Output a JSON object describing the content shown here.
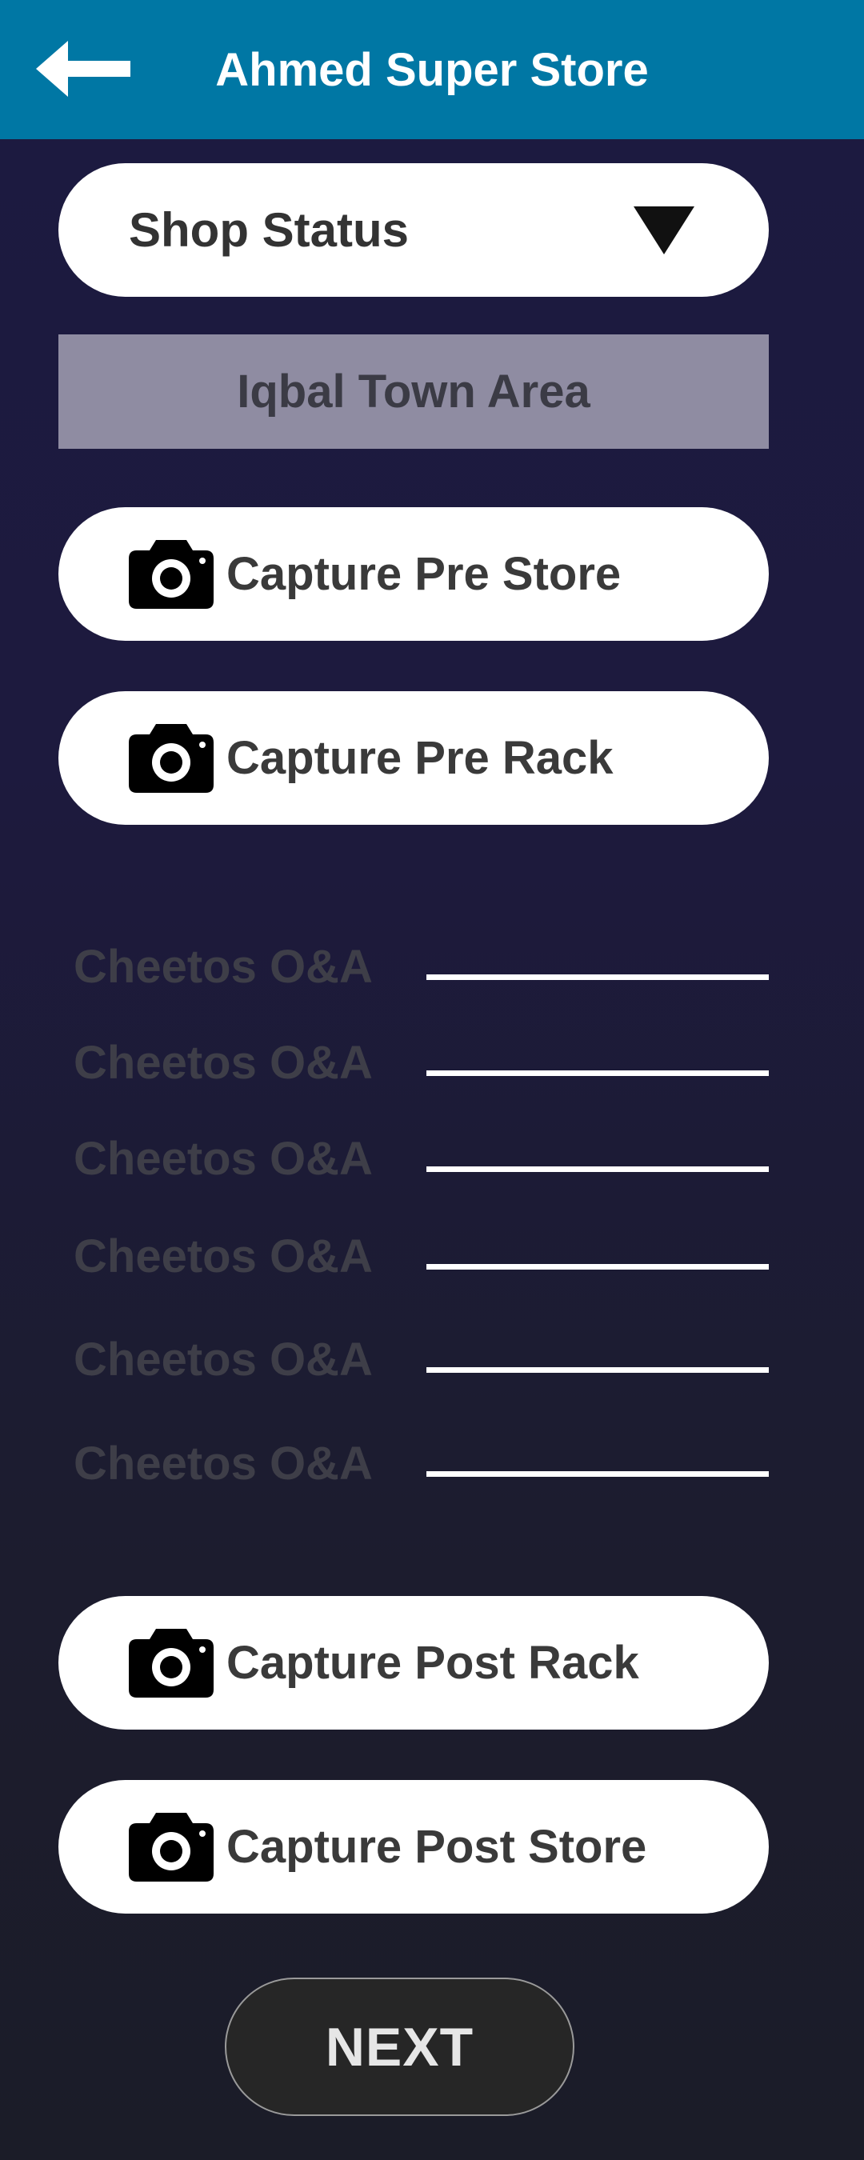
{
  "header": {
    "title": "Ahmed Super Store",
    "back_icon": "back-arrow-icon",
    "background_color": "#0077a4"
  },
  "shop_status": {
    "label": "Shop Status",
    "icon": "caret-down-icon"
  },
  "area": {
    "label": "Iqbal Town Area"
  },
  "capture_buttons": {
    "pre_store": "Capture Pre Store",
    "pre_rack": "Capture Pre Rack",
    "post_rack": "Capture Post Rack",
    "post_store": "Capture Post Store",
    "icon": "camera-icon"
  },
  "fields": [
    {
      "label": "Cheetos O&A",
      "value": ""
    },
    {
      "label": "Cheetos O&A",
      "value": ""
    },
    {
      "label": "Cheetos O&A",
      "value": ""
    },
    {
      "label": "Cheetos O&A",
      "value": ""
    },
    {
      "label": "Cheetos O&A",
      "value": ""
    },
    {
      "label": "Cheetos O&A",
      "value": ""
    }
  ],
  "next_button": {
    "label": "NEXT"
  }
}
